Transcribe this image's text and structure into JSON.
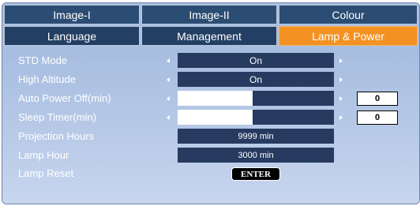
{
  "tabs_row1": [
    "Image-I",
    "Image-II",
    "Colour"
  ],
  "tabs_row2": [
    "Language",
    "Management",
    "Lamp & Power"
  ],
  "active_tab": "Lamp & Power",
  "rows": {
    "std_mode": {
      "label": "STD Mode",
      "value": "On"
    },
    "high_altitude": {
      "label": "High Altitude",
      "value": "On"
    },
    "auto_power_off": {
      "label": "Auto Power Off(min)",
      "value": "0",
      "slider_fraction": 0.48
    },
    "sleep_timer": {
      "label": "Sleep Timer(min)",
      "value": "0",
      "slider_fraction": 0.48
    },
    "projection_hours": {
      "label": "Projection Hours",
      "value": "9999 min"
    },
    "lamp_hour": {
      "label": "Lamp Hour",
      "value": "3000 min"
    },
    "lamp_reset": {
      "label": "Lamp Reset",
      "button": "ENTER"
    }
  },
  "icons": [
    "arrow-left-icon",
    "arrow-right-icon"
  ],
  "colors": {
    "panel_bg": "#a9bfe0",
    "tab_bg": "#2c4d73",
    "active_tab_bg": "#f39223",
    "value_box_bg": "#273a60"
  }
}
